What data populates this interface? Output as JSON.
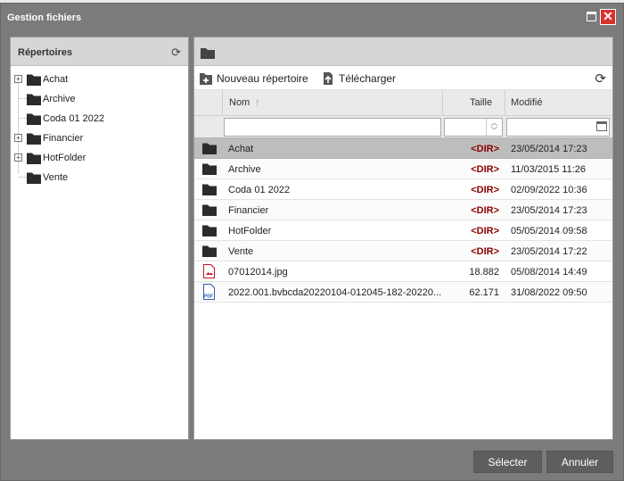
{
  "dialog": {
    "title": "Gestion fichiers",
    "close_glyph": "✕"
  },
  "directories_panel": {
    "title": "Répertoires",
    "refresh_icon": "refresh-icon",
    "tree": [
      {
        "label": "Achat",
        "expandable": true
      },
      {
        "label": "Archive",
        "expandable": false
      },
      {
        "label": "Coda 01 2022",
        "expandable": false
      },
      {
        "label": "Financier",
        "expandable": true
      },
      {
        "label": "HotFolder",
        "expandable": true
      },
      {
        "label": "Vente",
        "expandable": false
      }
    ]
  },
  "toolbar": {
    "new_folder_label": "Nouveau répertoire",
    "upload_label": "Télécharger"
  },
  "grid": {
    "columns": {
      "name": "Nom",
      "size": "Taille",
      "modified": "Modifié"
    },
    "sort_indicator": "↑",
    "rows": [
      {
        "type": "folder",
        "name": "Achat",
        "size": "<DIR>",
        "modified": "23/05/2014 17:23",
        "selected": true
      },
      {
        "type": "folder",
        "name": "Archive",
        "size": "<DIR>",
        "modified": "11/03/2015 11:26"
      },
      {
        "type": "folder",
        "name": "Coda 01 2022",
        "size": "<DIR>",
        "modified": "02/09/2022 10:36"
      },
      {
        "type": "folder",
        "name": "Financier",
        "size": "<DIR>",
        "modified": "23/05/2014 17:23"
      },
      {
        "type": "folder",
        "name": "HotFolder",
        "size": "<DIR>",
        "modified": "05/05/2014 09:58"
      },
      {
        "type": "folder",
        "name": "Vente",
        "size": "<DIR>",
        "modified": "23/05/2014 17:22"
      },
      {
        "type": "image",
        "name": "07012014.jpg",
        "size": "18.882",
        "modified": "05/08/2014 14:49"
      },
      {
        "type": "pdf",
        "name": "2022.001.bvbcda20220104-012045-182-20220...",
        "size": "62.171",
        "modified": "31/08/2022 09:50"
      }
    ]
  },
  "buttons": {
    "select_label": "Sélecter",
    "cancel_label": "Annuler"
  },
  "colors": {
    "dialog_bg": "#7b7b7b",
    "close_red": "#d9322c",
    "dir_text": "#8b0000",
    "pdf_blue": "#2e5bb8",
    "image_red": "#c8102e"
  }
}
